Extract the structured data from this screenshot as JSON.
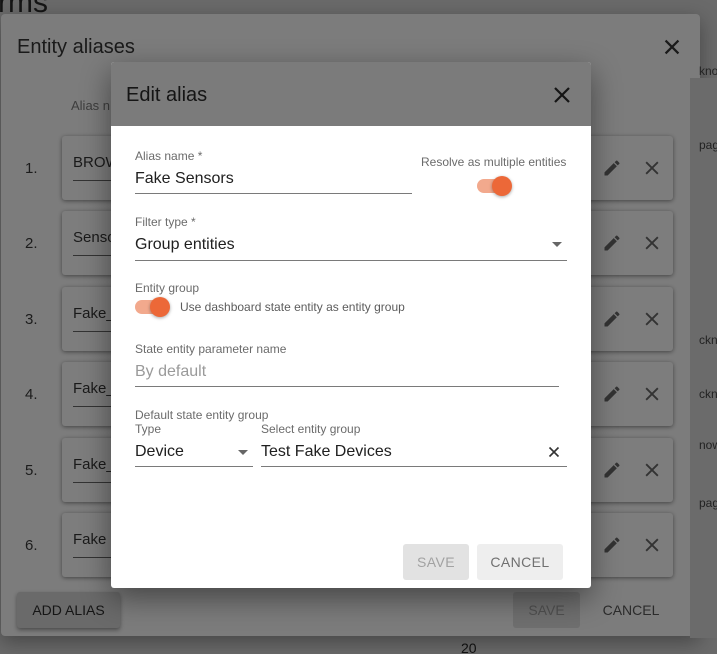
{
  "background": {
    "page_title": "rms",
    "right_texts": [
      "kno",
      "pag",
      "ckn",
      "ckn",
      "now",
      "pag"
    ],
    "footer_number": "20"
  },
  "entity_aliases_dialog": {
    "title": "Entity aliases",
    "column_header": "Alias n",
    "rows": [
      {
        "index": "1.",
        "name": "BROW"
      },
      {
        "index": "2.",
        "name": "Senso"
      },
      {
        "index": "3.",
        "name": "Fake_"
      },
      {
        "index": "4.",
        "name": "Fake_"
      },
      {
        "index": "5.",
        "name": "Fake_"
      },
      {
        "index": "6.",
        "name": "Fake "
      }
    ],
    "add_alias_label": "ADD ALIAS",
    "save_label": "SAVE",
    "cancel_label": "CANCEL"
  },
  "edit_alias_dialog": {
    "title": "Edit alias",
    "alias_name": {
      "label": "Alias name *",
      "value": "Fake Sensors"
    },
    "resolve_multiple": {
      "label": "Resolve as multiple entities",
      "checked": true
    },
    "filter_type": {
      "label": "Filter type *",
      "value": "Group entities"
    },
    "entity_group": {
      "label": "Entity group",
      "toggle_label": "Use dashboard state entity as entity group",
      "checked": true
    },
    "state_entity_param": {
      "label": "State entity parameter name",
      "placeholder": "By default"
    },
    "default_state_group": {
      "label": "Default state entity group",
      "type_label": "Type",
      "type_value": "Device",
      "group_label": "Select entity group",
      "group_value": "Test Fake Devices"
    },
    "save_label": "SAVE",
    "cancel_label": "CANCEL"
  },
  "colors": {
    "accent": "#ec6838",
    "accent_track": "#f2a98d",
    "overlay": "#7b7b7b"
  }
}
